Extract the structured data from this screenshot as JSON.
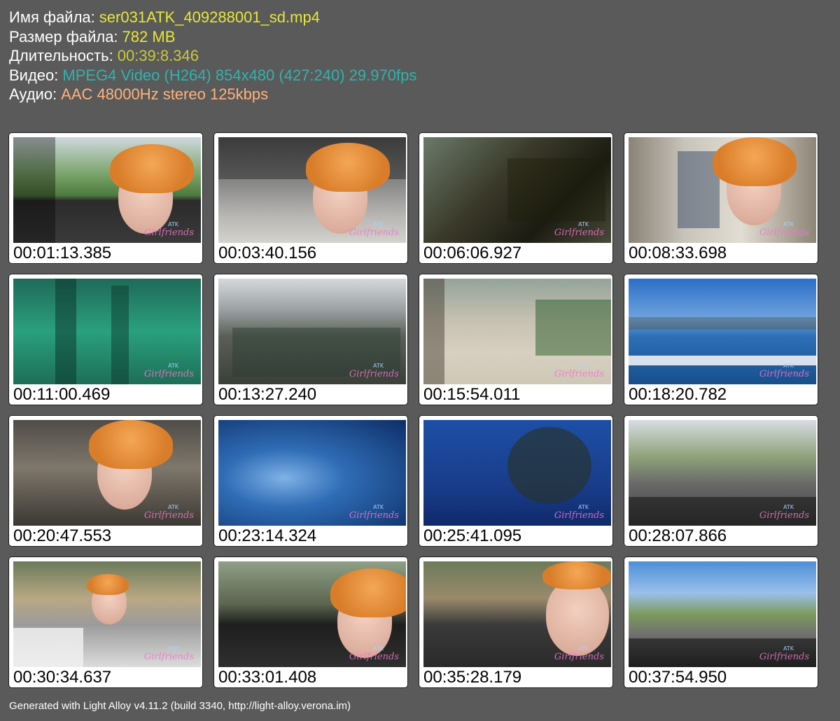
{
  "file_info": {
    "name_label": "Имя файла:",
    "name_value": "ser031ATK_409288001_sd.mp4",
    "size_label": "Размер файла:",
    "size_value": "782 MB",
    "duration_label": "Длительность:",
    "duration_value": "00:39:8.346",
    "video_label": "Видео:",
    "video_value": "MPEG4 Video (H264) 854x480 (427:240) 29.970fps",
    "audio_label": "Аудио:",
    "audio_value": "AAC 48000Hz stereo 125kbps"
  },
  "colors": {
    "background": "#5a5a5a",
    "name_value": "#e6e63a",
    "duration_value": "#c9c93a",
    "video_value": "#2fb3ad",
    "audio_value": "#ffb27a",
    "label": "#ffffff"
  },
  "watermark": {
    "top": "ATK",
    "bottom": "Girlfriends"
  },
  "thumbnails": [
    {
      "timestamp": "00:01:13.385"
    },
    {
      "timestamp": "00:03:40.156"
    },
    {
      "timestamp": "00:06:06.927"
    },
    {
      "timestamp": "00:08:33.698"
    },
    {
      "timestamp": "00:11:00.469"
    },
    {
      "timestamp": "00:13:27.240"
    },
    {
      "timestamp": "00:15:54.011"
    },
    {
      "timestamp": "00:18:20.782"
    },
    {
      "timestamp": "00:20:47.553"
    },
    {
      "timestamp": "00:23:14.324"
    },
    {
      "timestamp": "00:25:41.095"
    },
    {
      "timestamp": "00:28:07.866"
    },
    {
      "timestamp": "00:30:34.637"
    },
    {
      "timestamp": "00:33:01.408"
    },
    {
      "timestamp": "00:35:28.179"
    },
    {
      "timestamp": "00:37:54.950"
    }
  ],
  "footer": "Generated with Light Alloy v4.11.2 (build 3340, http://light-alloy.verona.im)"
}
